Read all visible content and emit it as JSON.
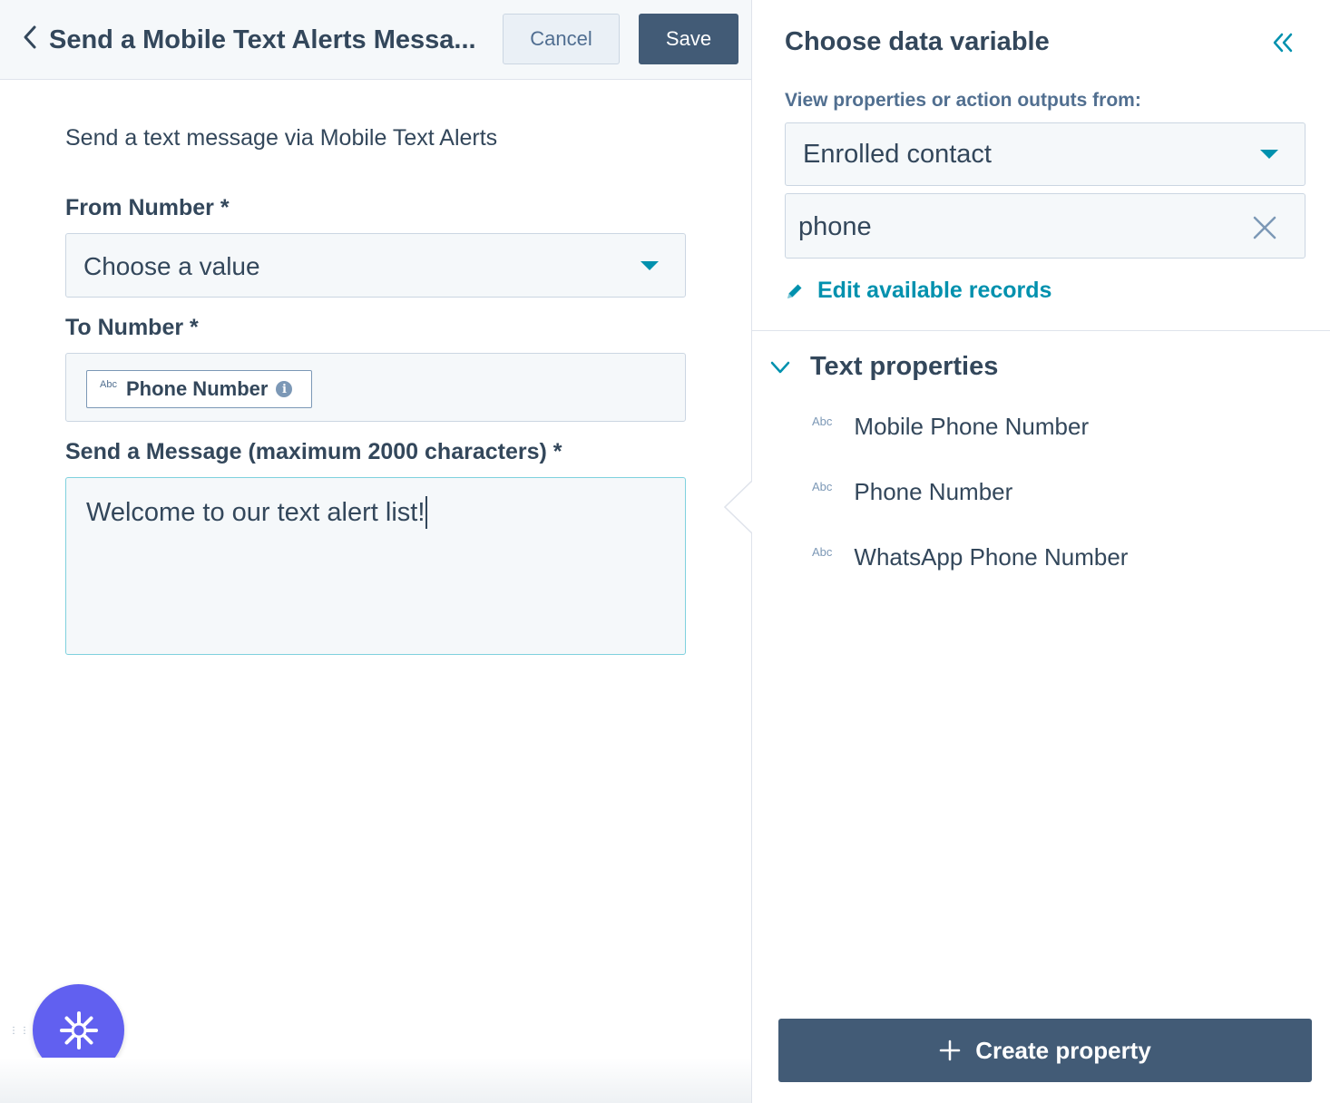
{
  "header": {
    "title": "Send a Mobile Text Alerts Messa...",
    "cancel_label": "Cancel",
    "save_label": "Save"
  },
  "form": {
    "description": "Send a text message via Mobile Text Alerts",
    "from_number": {
      "label": "From Number *",
      "value": "Choose a value"
    },
    "to_number": {
      "label": "To Number *",
      "token_type": "Abc",
      "token_label": "Phone Number"
    },
    "message": {
      "label": "Send a Message (maximum 2000 characters) *",
      "value": "Welcome to our text alert list!"
    }
  },
  "panel": {
    "title": "Choose data variable",
    "source_label": "View properties or action outputs from:",
    "source_value": "Enrolled contact",
    "search_value": "phone",
    "edit_link": "Edit available records",
    "section": {
      "title": "Text properties",
      "items": [
        {
          "type": "Abc",
          "label": "Mobile Phone Number"
        },
        {
          "type": "Abc",
          "label": "Phone Number"
        },
        {
          "type": "Abc",
          "label": "WhatsApp Phone Number"
        }
      ]
    },
    "create_button": "Create property"
  },
  "colors": {
    "primary_dark": "#425b76",
    "accent_link": "#0091ae",
    "fab": "#6160f0",
    "text": "#33475b"
  },
  "icons": [
    "back-chevron-icon",
    "caret-down-icon",
    "info-icon",
    "double-chevron-left-icon",
    "close-icon",
    "pencil-icon",
    "chevron-down-icon",
    "plus-icon",
    "sparkle-icon"
  ]
}
